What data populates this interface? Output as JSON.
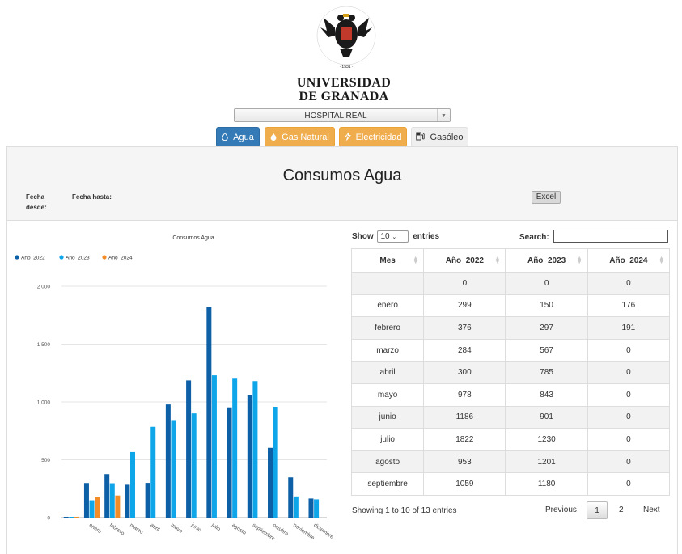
{
  "header": {
    "university_line1": "UNIVERSIDAD",
    "university_line2": "DE GRANADA",
    "building_selected": "HOSPITAL REAL"
  },
  "tabs": [
    {
      "label": "Agua",
      "icon": "droplet-icon",
      "color": "#337ab7"
    },
    {
      "label": "Gas Natural",
      "icon": "flame-icon",
      "color": "#f0ad4e"
    },
    {
      "label": "Electricidad",
      "icon": "lightning-icon",
      "color": "#f0ad4e"
    },
    {
      "label": "Gasóleo",
      "icon": "fuel-pump-icon",
      "color": "#efefef"
    }
  ],
  "panel": {
    "title": "Consumos Agua",
    "fecha_desde_label": "Fecha desde:",
    "fecha_hasta_label": "Fecha hasta:",
    "excel_label": "Excel"
  },
  "chart_data": {
    "type": "bar",
    "title": "Consumos Agua",
    "categories": [
      "",
      "enero",
      "febrero",
      "marzo",
      "abril",
      "mayo",
      "junio",
      "julio",
      "agosto",
      "septiembre",
      "octubre",
      "noviembre",
      "diciembre"
    ],
    "series": [
      {
        "name": "Año_2022",
        "color": "#0d5fa6",
        "values": [
          0,
          299,
          376,
          284,
          300,
          978,
          1186,
          1822,
          953,
          1059,
          603,
          348,
          165
        ]
      },
      {
        "name": "Año_2023",
        "color": "#0ea5e9",
        "values": [
          0,
          150,
          297,
          567,
          785,
          843,
          901,
          1230,
          1201,
          1180,
          958,
          183,
          158
        ]
      },
      {
        "name": "Año_2024",
        "color": "#f28c28",
        "values": [
          0,
          176,
          191,
          0,
          0,
          0,
          0,
          0,
          0,
          0,
          0,
          0,
          0
        ]
      }
    ],
    "ylim": [
      0,
      2000
    ],
    "yticks": [
      0,
      500,
      1000,
      1500,
      2000
    ],
    "ytick_labels": [
      "0",
      "500",
      "1 000",
      "1 500",
      "2 000"
    ],
    "grid": true,
    "legend_position": "top-left"
  },
  "table": {
    "show_label": "Show",
    "entries_label": "entries",
    "page_length": "10",
    "search_label": "Search:",
    "columns": [
      "Mes",
      "Año_2022",
      "Año_2023",
      "Año_2024"
    ],
    "rows": [
      [
        "",
        "0",
        "0",
        "0"
      ],
      [
        "enero",
        "299",
        "150",
        "176"
      ],
      [
        "febrero",
        "376",
        "297",
        "191"
      ],
      [
        "marzo",
        "284",
        "567",
        "0"
      ],
      [
        "abril",
        "300",
        "785",
        "0"
      ],
      [
        "mayo",
        "978",
        "843",
        "0"
      ],
      [
        "junio",
        "1186",
        "901",
        "0"
      ],
      [
        "julio",
        "1822",
        "1230",
        "0"
      ],
      [
        "agosto",
        "953",
        "1201",
        "0"
      ],
      [
        "septiembre",
        "1059",
        "1180",
        "0"
      ]
    ],
    "info": "Showing 1 to 10 of 13 entries",
    "pagination": {
      "previous": "Previous",
      "pages": [
        "1",
        "2"
      ],
      "next": "Next"
    }
  }
}
